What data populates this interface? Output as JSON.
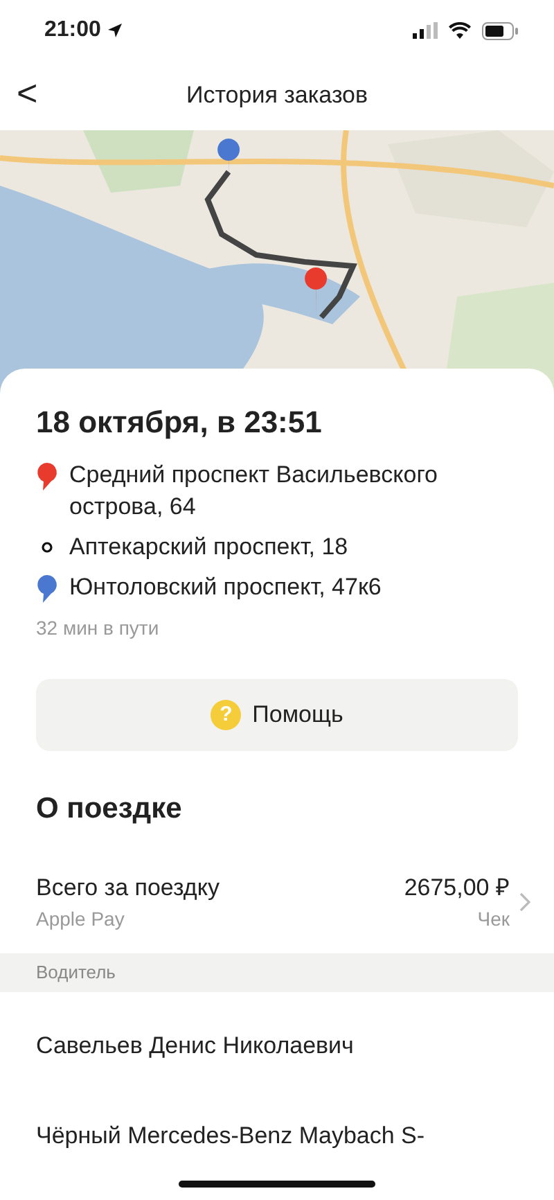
{
  "status_bar": {
    "time": "21:00"
  },
  "header": {
    "back": "<",
    "title": "История заказов"
  },
  "order": {
    "date": "18 октября, в 23:51",
    "stops": [
      {
        "kind": "start",
        "address": "Средний проспект Васильевского острова, 64"
      },
      {
        "kind": "waypoint",
        "address": "Аптекарский проспект, 18"
      },
      {
        "kind": "finish",
        "address": "Юнтоловский проспект, 47к6"
      }
    ],
    "duration": "32 мин в пути",
    "help_button": {
      "icon": "?",
      "label": "Помощь"
    }
  },
  "trip": {
    "heading": "О поездке",
    "total_label": "Всего за поездку",
    "payment": "Apple Pay",
    "amount": "2675,00 ₽",
    "receipt": "Чек"
  },
  "driver_section": {
    "heading": "Водитель",
    "name": "Савельев Денис Николаевич",
    "car": "Чёрный Mercedes-Benz Maybach S-"
  }
}
